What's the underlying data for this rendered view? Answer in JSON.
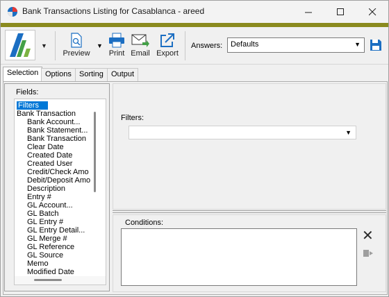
{
  "window": {
    "title": "Bank Transactions Listing for Casablanca - areed",
    "controls": {
      "minimize": "—",
      "maximize": "☐",
      "close": "✕"
    }
  },
  "toolbar": {
    "logo": "app-logo",
    "preview_label": "Preview",
    "print_label": "Print",
    "email_label": "Email",
    "export_label": "Export",
    "answers_label": "Answers:",
    "answers_value": "Defaults"
  },
  "tabs": [
    {
      "label": "Selection",
      "active": true
    },
    {
      "label": "Options",
      "active": false
    },
    {
      "label": "Sorting",
      "active": false
    },
    {
      "label": "Output",
      "active": false
    }
  ],
  "fields": {
    "label": "Fields:",
    "items": [
      {
        "label": "Filters",
        "level": 0,
        "selected": true
      },
      {
        "label": "Bank Transaction",
        "level": 0,
        "selected": false
      },
      {
        "label": "Bank Account...",
        "level": 1,
        "selected": false
      },
      {
        "label": "Bank Statement...",
        "level": 1,
        "selected": false
      },
      {
        "label": "Bank Transaction",
        "level": 1,
        "selected": false
      },
      {
        "label": "Clear Date",
        "level": 1,
        "selected": false
      },
      {
        "label": "Created Date",
        "level": 1,
        "selected": false
      },
      {
        "label": "Created User",
        "level": 1,
        "selected": false
      },
      {
        "label": "Credit/Check Amo",
        "level": 1,
        "selected": false
      },
      {
        "label": "Debit/Deposit Amo",
        "level": 1,
        "selected": false
      },
      {
        "label": "Description",
        "level": 1,
        "selected": false
      },
      {
        "label": "Entry #",
        "level": 1,
        "selected": false
      },
      {
        "label": "GL Account...",
        "level": 1,
        "selected": false
      },
      {
        "label": "GL Batch",
        "level": 1,
        "selected": false
      },
      {
        "label": "GL Entry #",
        "level": 1,
        "selected": false
      },
      {
        "label": "GL Entry Detail...",
        "level": 1,
        "selected": false
      },
      {
        "label": "GL Merge #",
        "level": 1,
        "selected": false
      },
      {
        "label": "GL Reference",
        "level": 1,
        "selected": false
      },
      {
        "label": "GL Source",
        "level": 1,
        "selected": false
      },
      {
        "label": "Memo",
        "level": 1,
        "selected": false
      },
      {
        "label": "Modified Date",
        "level": 1,
        "selected": false
      }
    ]
  },
  "filters": {
    "label": "Filters:",
    "value": ""
  },
  "conditions": {
    "label": "Conditions:",
    "value": ""
  },
  "colors": {
    "accent_bar": "#8a8a1e",
    "selection": "#0078d7",
    "icon_blue": "#1b6ec2"
  }
}
